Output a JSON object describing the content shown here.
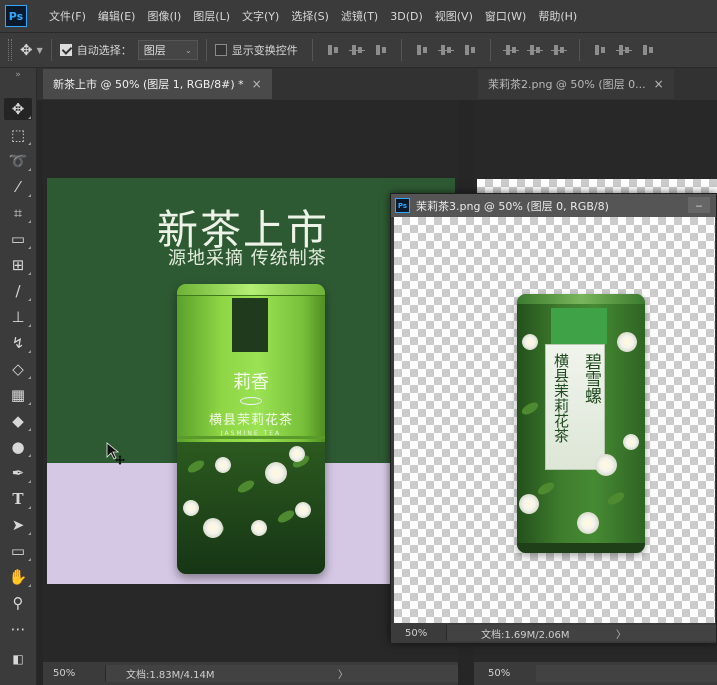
{
  "menu": {
    "logo": "Ps",
    "items": [
      "文件(F)",
      "编辑(E)",
      "图像(I)",
      "图层(L)",
      "文字(Y)",
      "选择(S)",
      "滤镜(T)",
      "3D(D)",
      "视图(V)",
      "窗口(W)",
      "帮助(H)"
    ]
  },
  "options": {
    "auto_select_label": "自动选择：",
    "auto_select_checked": true,
    "layer_dropdown": "图层",
    "show_transform_label": "显示变换控件",
    "show_transform_checked": false
  },
  "tabs": {
    "main": {
      "label": "新茶上市 @ 50% (图层 1, RGB/8#) *",
      "close": "×"
    },
    "second": {
      "label": "茉莉茶2.png @ 50% (图层 0...",
      "close": "×"
    }
  },
  "floating_window": {
    "logo": "Ps",
    "title": "茉莉茶3.png @ 50% (图层 0, RGB/8)",
    "minimize": "‒",
    "zoom": "50%",
    "doc": "文档:1.69M/2.06M",
    "arrow": "〉"
  },
  "canvas": {
    "headline": "新茶上市",
    "subline": "源地采摘 传统制茶",
    "can_name": "莉香",
    "can_title": "横县茉莉花茶",
    "can_en": "JASMINE TEA",
    "float_can_left": "横县茉莉花茶",
    "float_can_right": "碧雪螺"
  },
  "status_main": {
    "zoom": "50%",
    "doc": "文档:1.83M/4.14M",
    "arrow": "〉"
  },
  "status_right": {
    "zoom": "50%"
  },
  "colors": {
    "app_bg": "#262626",
    "panel": "#3b3b3b",
    "artboard_green": "#2e5a33",
    "lavender": "#d5c8e5",
    "accent": "#31a8ff"
  },
  "toolbar_icons": [
    "move-tool-icon",
    "marquee-tool-icon",
    "lasso-tool-icon",
    "magic-wand-icon",
    "crop-tool-icon",
    "eyedropper-icon",
    "healing-brush-icon",
    "brush-tool-icon",
    "clone-stamp-icon",
    "history-brush-icon",
    "eraser-icon",
    "gradient-tool-icon",
    "blur-tool-icon",
    "dodge-tool-icon",
    "pen-tool-icon",
    "type-tool-icon",
    "path-select-icon",
    "rectangle-tool-icon",
    "hand-tool-icon",
    "zoom-tool-icon",
    "more-tools-icon"
  ]
}
